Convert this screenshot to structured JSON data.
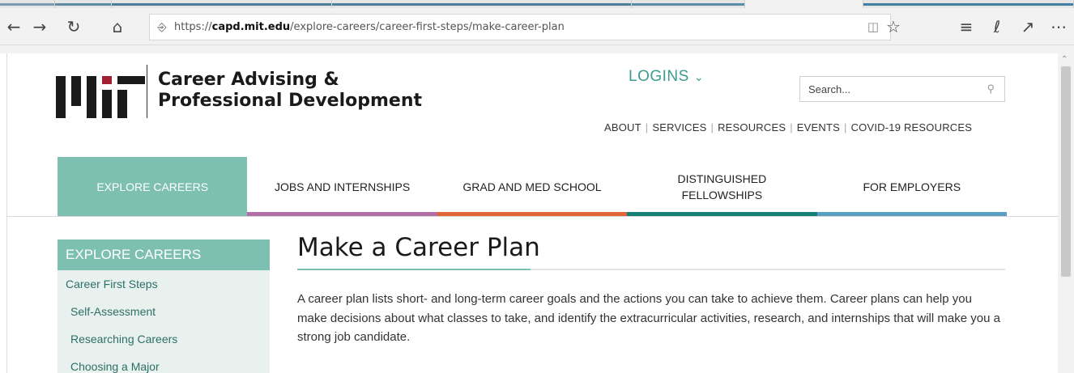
{
  "browser": {
    "url_prefix": "https://",
    "url_host": "capd.mit.edu",
    "url_path": "/explore-careers/career-first-steps/make-career-plan",
    "icons": {
      "back": "back-arrow-icon",
      "forward": "forward-arrow-icon",
      "refresh": "refresh-icon",
      "home": "home-icon",
      "lock": "lock-icon",
      "reading_view": "reading-view-icon",
      "favorite": "star-icon",
      "favorites_bar": "favorites-icon",
      "notes": "pen-icon",
      "share": "share-icon",
      "more": "more-icon"
    },
    "tab_colors": [
      "#7a9bb0",
      "#5f8aa5",
      "#4a7d99",
      "#4d7f9c",
      "#5a8ca8",
      "#3f7fa1"
    ]
  },
  "header": {
    "logo_name": "MIT logo",
    "brand_line1": "Career Advising &",
    "brand_line2": "Professional Development",
    "logins_label": "LOGINS",
    "search_placeholder": "Search...",
    "utility_links": [
      "ABOUT",
      "SERVICES",
      "RESOURCES",
      "EVENTS",
      "COVID-19 RESOURCES"
    ]
  },
  "main_nav": [
    {
      "label": "EXPLORE CAREERS",
      "bar_color": "#7dc0b2",
      "active": true
    },
    {
      "label": "JOBS AND INTERNSHIPS",
      "bar_color": "#b06fa6",
      "active": false
    },
    {
      "label": "GRAD AND MED SCHOOL",
      "bar_color": "#e0663a",
      "active": false
    },
    {
      "label": "DISTINGUISHED FELLOWSHIPS",
      "line1": "DISTINGUISHED",
      "line2": "FELLOWSHIPS",
      "bar_color": "#127f76",
      "active": false
    },
    {
      "label": "FOR EMPLOYERS",
      "bar_color": "#5b9ec2",
      "active": false
    }
  ],
  "sidebar": {
    "heading": "EXPLORE CAREERS",
    "links": [
      "Career First Steps",
      "Self-Assessment",
      "Researching Careers",
      "Choosing a Major"
    ]
  },
  "content": {
    "title": "Make a Career Plan",
    "paragraph": "A career plan lists short- and long-term career goals and the actions you can take to achieve them. Career plans can help you make decisions about what classes to take, and identify the extracurricular activities, research, and internships that will make you a strong job candidate."
  },
  "colors": {
    "accent_teal": "#7dc0b2",
    "logins_teal": "#3a9d90",
    "sidebar_bg": "#e9f1ee",
    "link_teal": "#2c6f66"
  }
}
